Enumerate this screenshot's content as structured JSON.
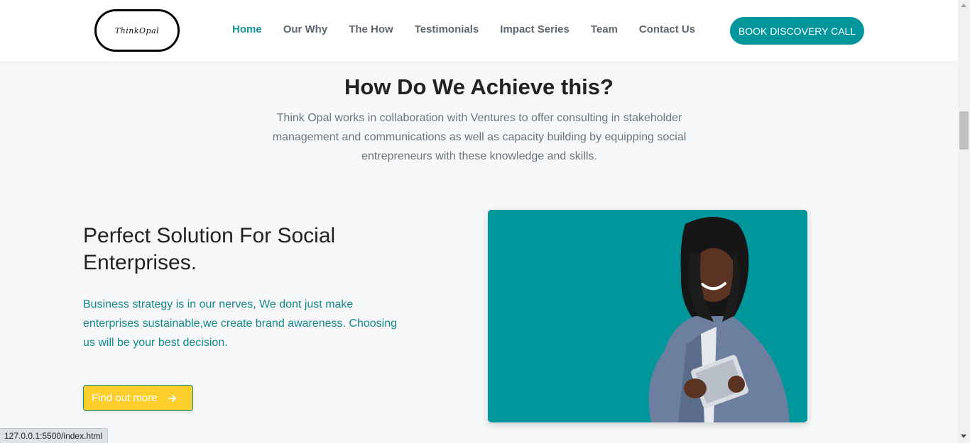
{
  "header": {
    "logo_text": "ThinkOpal",
    "nav": [
      {
        "label": "Home",
        "active": true
      },
      {
        "label": "Our Why",
        "active": false
      },
      {
        "label": "The How",
        "active": false
      },
      {
        "label": "Testimonials",
        "active": false
      },
      {
        "label": "Impact Series",
        "active": false
      },
      {
        "label": "Team",
        "active": false
      },
      {
        "label": "Contact Us",
        "active": false
      }
    ],
    "cta_label": "BOOK DISCOVERY CALL"
  },
  "section": {
    "title": "How Do We Achieve this?",
    "description": "Think Opal works in collaboration with Ventures to offer consulting in stakeholder management and communications as well as capacity building by equipping social entrepreneurs with these knowledge and skills."
  },
  "feature": {
    "title": "Perfect Solution For Social Enterprises.",
    "text": "Business strategy is in our nerves, We dont just make enterprises sustainable,we create brand awareness. Choosing us will be your best decision.",
    "button_label": "Find out more",
    "button_icon": "arrow-right-icon"
  },
  "image": {
    "subject": "woman-with-tablet"
  },
  "status_bar": {
    "url": "127.0.0.1:5500/index.html"
  },
  "colors": {
    "accent": "#00969c",
    "nav_active": "#149497",
    "button_yellow": "#fccf2d",
    "feature_text": "#12898c"
  }
}
